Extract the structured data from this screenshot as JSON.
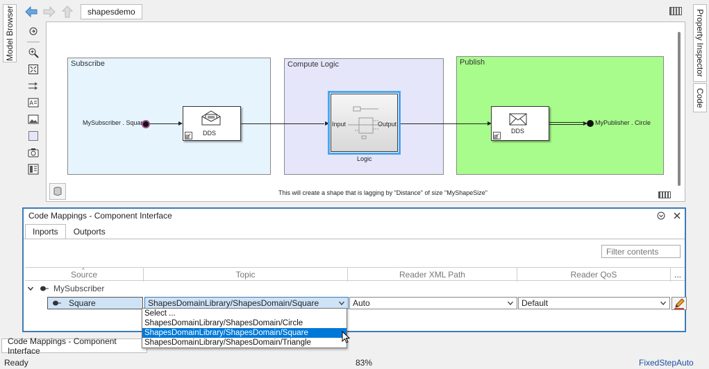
{
  "side_tabs": {
    "left": "Model Browser",
    "right_top": "Property Inspector",
    "right_bottom": "Code"
  },
  "toolbar": {
    "breadcrumb": "shapesdemo"
  },
  "diagram": {
    "areas": [
      {
        "title": "Subscribe",
        "color": "#e6f4fe"
      },
      {
        "title": "Compute Logic",
        "color": "#e6e6fb"
      },
      {
        "title": "Publish",
        "color": "#a8fc8c"
      }
    ],
    "blocks": {
      "dds_in": "DDS",
      "logic": "Logic",
      "logic_in": "Input",
      "logic_out": "Output",
      "dds_out": "DDS"
    },
    "ports": {
      "subscriber": "MySubscriber . Square",
      "publisher": "MyPublisher . Circle"
    },
    "note": "This will create a shape that is lagging by \"Distance\" of size \"MyShapeSize\""
  },
  "code_mappings": {
    "title": "Code Mappings - Component Interface",
    "tabs": [
      "Inports",
      "Outports"
    ],
    "active_tab": "Inports",
    "filter_placeholder": "Filter contents",
    "columns": [
      "Source",
      "Topic",
      "Reader XML Path",
      "Reader QoS",
      "..."
    ],
    "group": "MySubscriber",
    "row": {
      "source": "Square",
      "topic": "ShapesDomainLibrary/ShapesDomain/Square",
      "xml_path": "Auto",
      "qos": "Default"
    },
    "dropdown_options": [
      "Select ...",
      "ShapesDomainLibrary/ShapesDomain/Circle",
      "ShapesDomainLibrary/ShapesDomain/Square",
      "ShapesDomainLibrary/ShapesDomain/Triangle"
    ],
    "selected_option_index": 2
  },
  "bottom_tab": "Code Mappings - Component Interface",
  "status": {
    "left": "Ready",
    "zoom": "83%",
    "solver": "FixedStepAuto"
  },
  "colors": {
    "accent": "#3d7ab8",
    "selection": "#0078d7",
    "selected_cell": "#cfe3f7"
  }
}
